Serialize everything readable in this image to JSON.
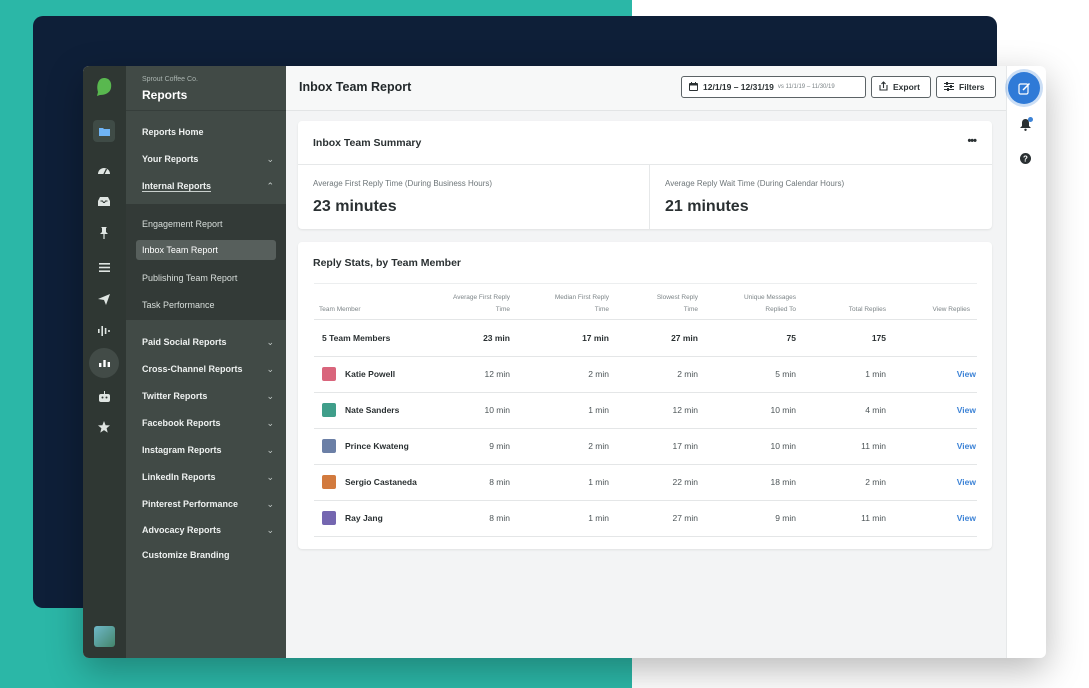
{
  "brand": {
    "org": "Sprout Coffee Co.",
    "section": "Reports"
  },
  "rail_icons": [
    "folder-icon",
    "dashboard-icon",
    "inbox-icon",
    "pin-icon",
    "list-icon",
    "send-icon",
    "listening-icon",
    "reports-icon",
    "bot-icon",
    "star-icon"
  ],
  "nav": {
    "items_top": [
      {
        "label": "Reports Home",
        "chevron": ""
      },
      {
        "label": "Your Reports",
        "chevron": "⌄"
      },
      {
        "label": "Internal Reports",
        "chevron": "⌃"
      }
    ],
    "sub_items": [
      {
        "label": "Engagement Report"
      },
      {
        "label": "Inbox Team Report"
      },
      {
        "label": "Publishing Team Report"
      },
      {
        "label": "Task Performance"
      }
    ],
    "items_bottom": [
      {
        "label": "Paid Social Reports",
        "chevron": "⌄"
      },
      {
        "label": "Cross-Channel Reports",
        "chevron": "⌄"
      },
      {
        "label": "Twitter Reports",
        "chevron": "⌄"
      },
      {
        "label": "Facebook Reports",
        "chevron": "⌄"
      },
      {
        "label": "Instagram Reports",
        "chevron": "⌄"
      },
      {
        "label": "LinkedIn Reports",
        "chevron": "⌄"
      },
      {
        "label": "Pinterest Performance",
        "chevron": "⌄"
      },
      {
        "label": "Advocacy Reports",
        "chevron": "⌄"
      },
      {
        "label": "Customize Branding",
        "chevron": ""
      }
    ]
  },
  "header": {
    "title": "Inbox Team Report",
    "date_range": "12/1/19 – 12/31/19",
    "compare_range": "vs 11/1/19 – 11/30/19",
    "export_label": "Export",
    "filters_label": "Filters"
  },
  "summary": {
    "title": "Inbox Team Summary",
    "more": "•••",
    "metrics": [
      {
        "label": "Average First Reply Time (During Business Hours)",
        "value": "23 minutes"
      },
      {
        "label": "Average Reply Wait Time (During Calendar Hours)",
        "value": "21 minutes"
      }
    ]
  },
  "table": {
    "title": "Reply Stats, by Team Member",
    "headers": [
      "Team Member",
      "Average First Reply Time",
      "Median First Reply Time",
      "Slowest Reply Time",
      "Unique Messages Replied To",
      "Total Replies",
      "View Replies"
    ],
    "header_lines": [
      [
        "Team Member"
      ],
      [
        "Average First Reply",
        "Time"
      ],
      [
        "Median First Reply",
        "Time"
      ],
      [
        "Slowest Reply",
        "Time"
      ],
      [
        "Unique Messages",
        "Replied To"
      ],
      [
        "Total Replies"
      ],
      [
        "View Replies"
      ]
    ],
    "total_row": {
      "name": "5 Team Members",
      "avg": "23 min",
      "median": "17 min",
      "slowest": "27 min",
      "unique": "75",
      "total": "175",
      "view": ""
    },
    "rows": [
      {
        "name": "Katie Powell",
        "avg": "12 min",
        "median": "2 min",
        "slowest": "2 min",
        "unique": "5 min",
        "total": "1 min",
        "view": "View",
        "avatar_color": "#d9657c"
      },
      {
        "name": "Nate Sanders",
        "avg": "10 min",
        "median": "1 min",
        "slowest": "12 min",
        "unique": "10 min",
        "total": "4 min",
        "view": "View",
        "avatar_color": "#3f9e8a"
      },
      {
        "name": "Prince Kwateng",
        "avg": "9 min",
        "median": "2 min",
        "slowest": "17 min",
        "unique": "10 min",
        "total": "11 min",
        "view": "View",
        "avatar_color": "#6b7fa6"
      },
      {
        "name": "Sergio Castaneda",
        "avg": "8 min",
        "median": "1 min",
        "slowest": "22 min",
        "unique": "18 min",
        "total": "2 min",
        "view": "View",
        "avatar_color": "#d27a3e"
      },
      {
        "name": "Ray Jang",
        "avg": "8 min",
        "median": "1 min",
        "slowest": "27 min",
        "unique": "9 min",
        "total": "11 min",
        "view": "View",
        "avatar_color": "#7466b0"
      }
    ]
  },
  "colors": {
    "accent": "#2f7ad7",
    "link": "#3d83d6",
    "brand_green": "#59b84f",
    "teal_bg": "#2bb7a7",
    "navy_bg": "#0e1f38"
  }
}
